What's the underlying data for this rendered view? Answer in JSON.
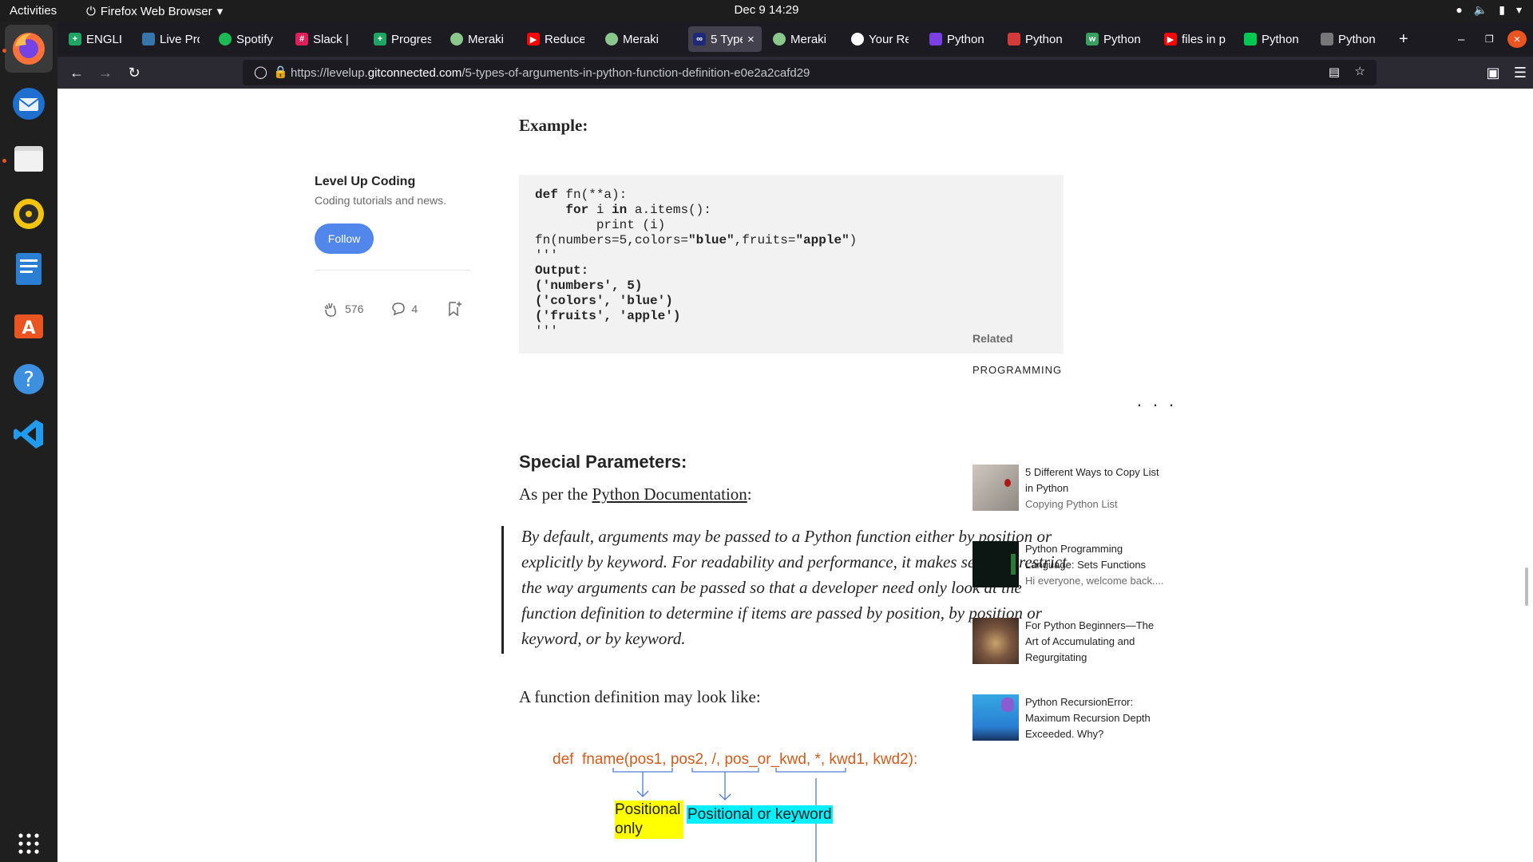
{
  "topbar": {
    "activities": "Activities",
    "app_name": "Firefox Web Browser",
    "clock": "Dec 9  14:29"
  },
  "browser": {
    "tabs": [
      {
        "label": "ENGLISH",
        "icon": "sheets-icon"
      },
      {
        "label": "Live Pro",
        "icon": "python-icon"
      },
      {
        "label": "Spotify",
        "icon": "spotify-icon"
      },
      {
        "label": "Slack | I",
        "icon": "slack-icon"
      },
      {
        "label": "Progress",
        "icon": "sheets-icon"
      },
      {
        "label": "Meraki",
        "icon": "meraki-icon"
      },
      {
        "label": "Reduce",
        "icon": "youtube-icon"
      },
      {
        "label": "Meraki",
        "icon": "meraki-icon"
      },
      {
        "label": "5 Type",
        "icon": "levelup-icon"
      },
      {
        "label": "Meraki",
        "icon": "meraki-icon"
      },
      {
        "label": "Your Re",
        "icon": "github-icon"
      },
      {
        "label": "Python",
        "icon": "python-icon"
      },
      {
        "label": "Python",
        "icon": "python-icon"
      },
      {
        "label": "Python",
        "icon": "python-icon"
      },
      {
        "label": "files in p",
        "icon": "youtube-icon"
      },
      {
        "label": "Python",
        "icon": "python-icon"
      },
      {
        "label": "Python",
        "icon": "python-icon"
      }
    ],
    "url_prefix": "https://levelup.",
    "url_domain": "gitconnected.com",
    "url_path": "/5-types-of-arguments-in-python-function-definition-e0e2a2cafd29"
  },
  "article": {
    "example_heading": "Example:",
    "code_lines": [
      "def fn(**a):",
      "    for i in a.items():",
      "        print (i)",
      "fn(numbers=5,colors=\"blue\",fruits=\"apple\")",
      "'''",
      "Output:",
      "('numbers', 5)",
      "('colors', 'blue')",
      "('fruits', 'apple')",
      "'''"
    ],
    "separator": "...",
    "special_heading": "Special Parameters:",
    "as_per_prefix": "As per the ",
    "as_per_link": "Python Documentation",
    "as_per_suffix": ":",
    "quote": "By default, arguments may be passed to a Python function either by position or explicitly by keyword. For readability and performance, it makes sense to restrict the way arguments can be passed so that a developer need only look at the function definition to determine if items are passed by position, by position or keyword, or by keyword.",
    "fn_def_text": "A function definition may look like:",
    "diagram": {
      "code": "def  fname(pos1, pos2, /, pos_or_kwd, *, kwd1, kwd2):",
      "label_positional_only": "Positional only",
      "label_positional_or_keyword": "Positional or keyword"
    }
  },
  "sidebar": {
    "publication_name": "Level Up Coding",
    "publication_tagline": "Coding tutorials and news.",
    "follow_label": "Follow",
    "claps": "576",
    "responses": "4",
    "related_heading": "Related",
    "related_category": "PROGRAMMING",
    "related": [
      {
        "title": "5 Different Ways to Copy List in Python",
        "subtitle": "Copying Python List",
        "thumb_color": "#bdb5ad"
      },
      {
        "title": "Python Programming Language: Sets Functions",
        "subtitle": "Hi everyone, welcome back....",
        "thumb_color": "#0c1612"
      },
      {
        "title": "For Python Beginners—The Art of Accumulating and Regurgitating",
        "subtitle": "",
        "thumb_color": "#8d6a55"
      },
      {
        "title": "Python RecursionError: Maximum Recursion Depth Exceeded. Why?",
        "subtitle": "",
        "thumb_color": "#3aa0d8"
      }
    ]
  },
  "colors": {
    "follow_button": "#5186ea",
    "diagram_code": "#d35c1d",
    "highlight_yellow": "#ffff00",
    "highlight_cyan": "#00f0ff",
    "firefox_tabstrip": "#1c1b22",
    "firefox_toolbar": "#2b2a33"
  }
}
